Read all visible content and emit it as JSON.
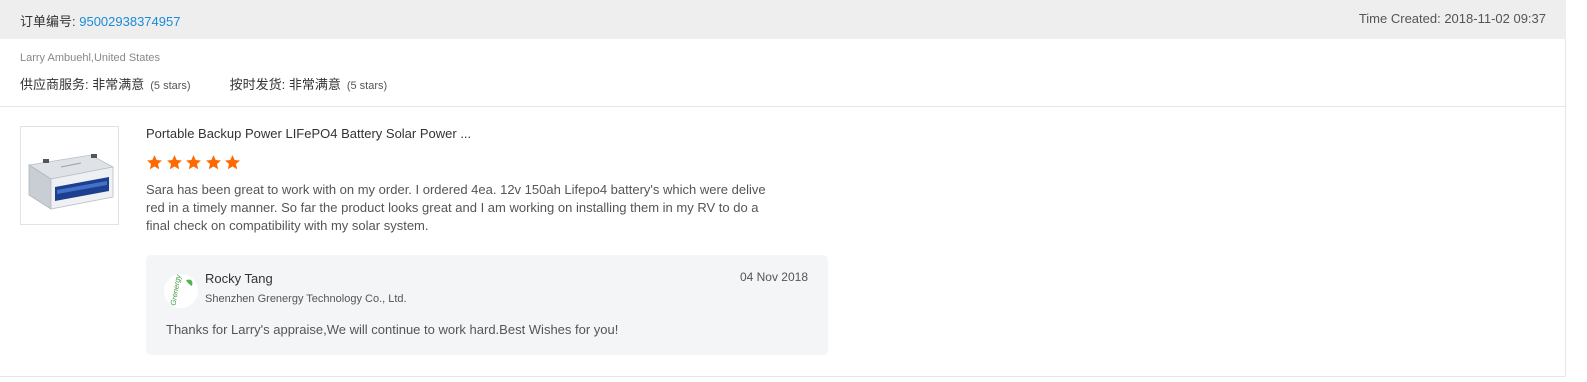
{
  "header": {
    "order_label": "订单编号: ",
    "order_number": "95002938374957",
    "time_created": "Time Created: 2018-11-02 09:37"
  },
  "buyer": {
    "name_location": "Larry Ambuehl,United States",
    "ratings": [
      {
        "label": "供应商服务: ",
        "value": "非常满意",
        "stars": "(5 stars)"
      },
      {
        "label": "按时发货: ",
        "value": "非常满意",
        "stars": "(5 stars)"
      }
    ]
  },
  "review": {
    "product_title": "Portable Backup Power LIFePO4 Battery Solar Power ...",
    "star_count": 5,
    "star_color": "#ff6a00",
    "lines": [
      "Sara has been great to work with on my order. I ordered 4ea. 12v 150ah Lifepo4 battery's which were delive",
      "red in a timely manner.  So far the product looks great and I am working on installing them in my RV to do a",
      "final check on compatibility with my solar system."
    ]
  },
  "reply": {
    "logo_text": "Grenergy",
    "name": "Rocky Tang",
    "company": "Shenzhen Grenergy Technology Co., Ltd.",
    "date": "04 Nov 2018",
    "text": "Thanks for Larry's appraise,We will continue to work hard.Best Wishes for you!"
  },
  "colors": {
    "link": "#1a8cd8",
    "header_bg": "#eeeeee",
    "reply_bg": "#f4f5f7"
  }
}
